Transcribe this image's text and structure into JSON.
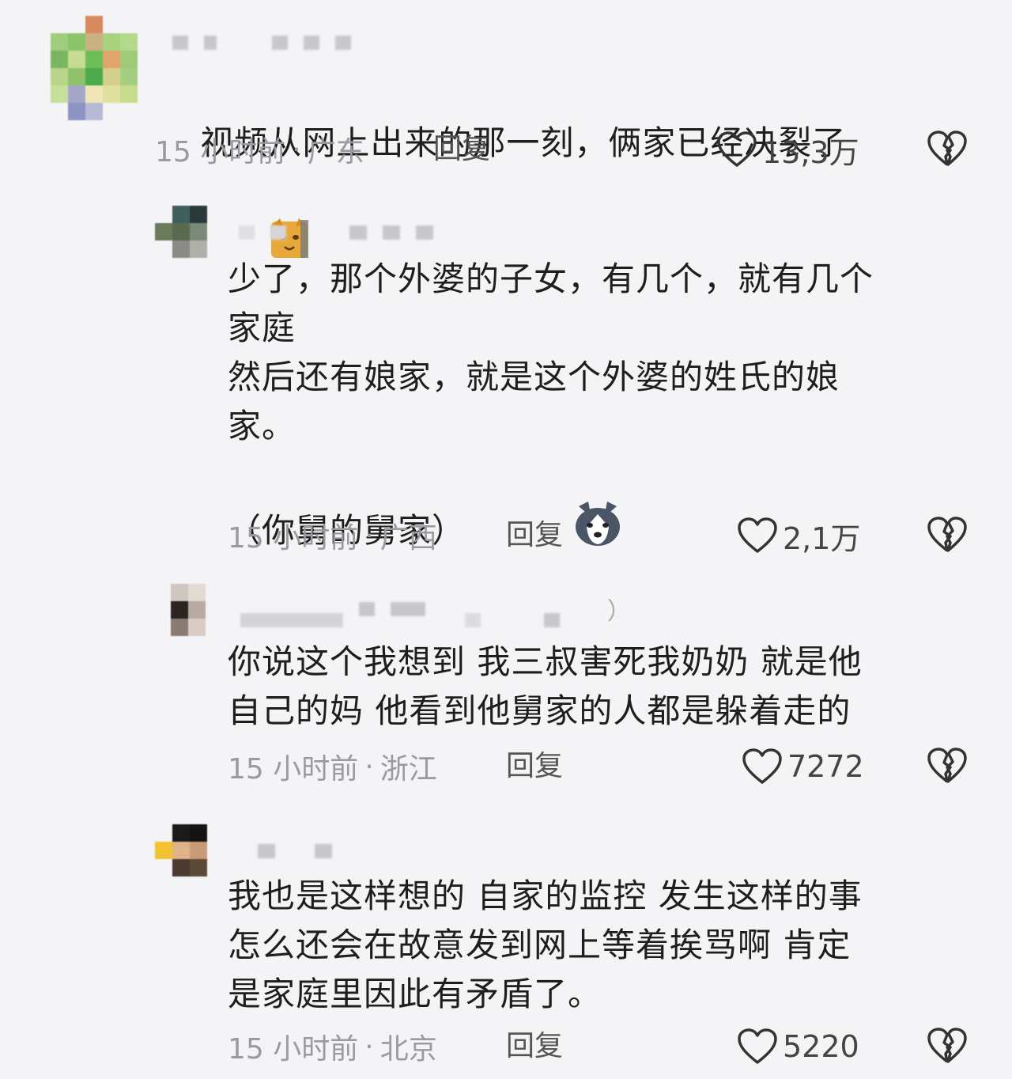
{
  "comments": [
    {
      "text": "视频从网上出来的那一刻，俩家已经决裂了",
      "time": "15 小时前",
      "sep": "·",
      "location": "广东",
      "reply_label": "回复",
      "likes": "13,3万",
      "emoji_icon": "cat-face-emoji-icon"
    },
    {
      "text_lines": [
        "少了，那个外婆的子女，有几个，就有几个",
        "家庭",
        "然后还有娘家，就是这个外婆的姓氏的娘",
        "家。",
        "（你舅的舅家）"
      ],
      "time": "15 小时前",
      "sep": "·",
      "location": "广西",
      "reply_label": "回复",
      "likes": "2,1万",
      "emoji_icon": "husky-dog-emoji-icon"
    },
    {
      "text_lines": [
        "你说这个我想到 我三叔害死我奶奶 就是他",
        "自己的妈 他看到他舅家的人都是躲着走的"
      ],
      "name_suffix": "）",
      "time": "15 小时前",
      "sep": "·",
      "location": "浙江",
      "reply_label": "回复",
      "likes": "7272"
    },
    {
      "text_lines": [
        "我也是这样想的 自家的监控 发生这样的事",
        "怎么还会在故意发到网上等着挨骂啊 肯定",
        "是家庭里因此有矛盾了。"
      ],
      "time": "15 小时前",
      "sep": "·",
      "location": "北京",
      "reply_label": "回复",
      "likes": "5220"
    }
  ],
  "colors": {
    "background": "#f4f4f6",
    "meta_text": "#9a9a9f",
    "body_text": "#1e1e1e"
  }
}
